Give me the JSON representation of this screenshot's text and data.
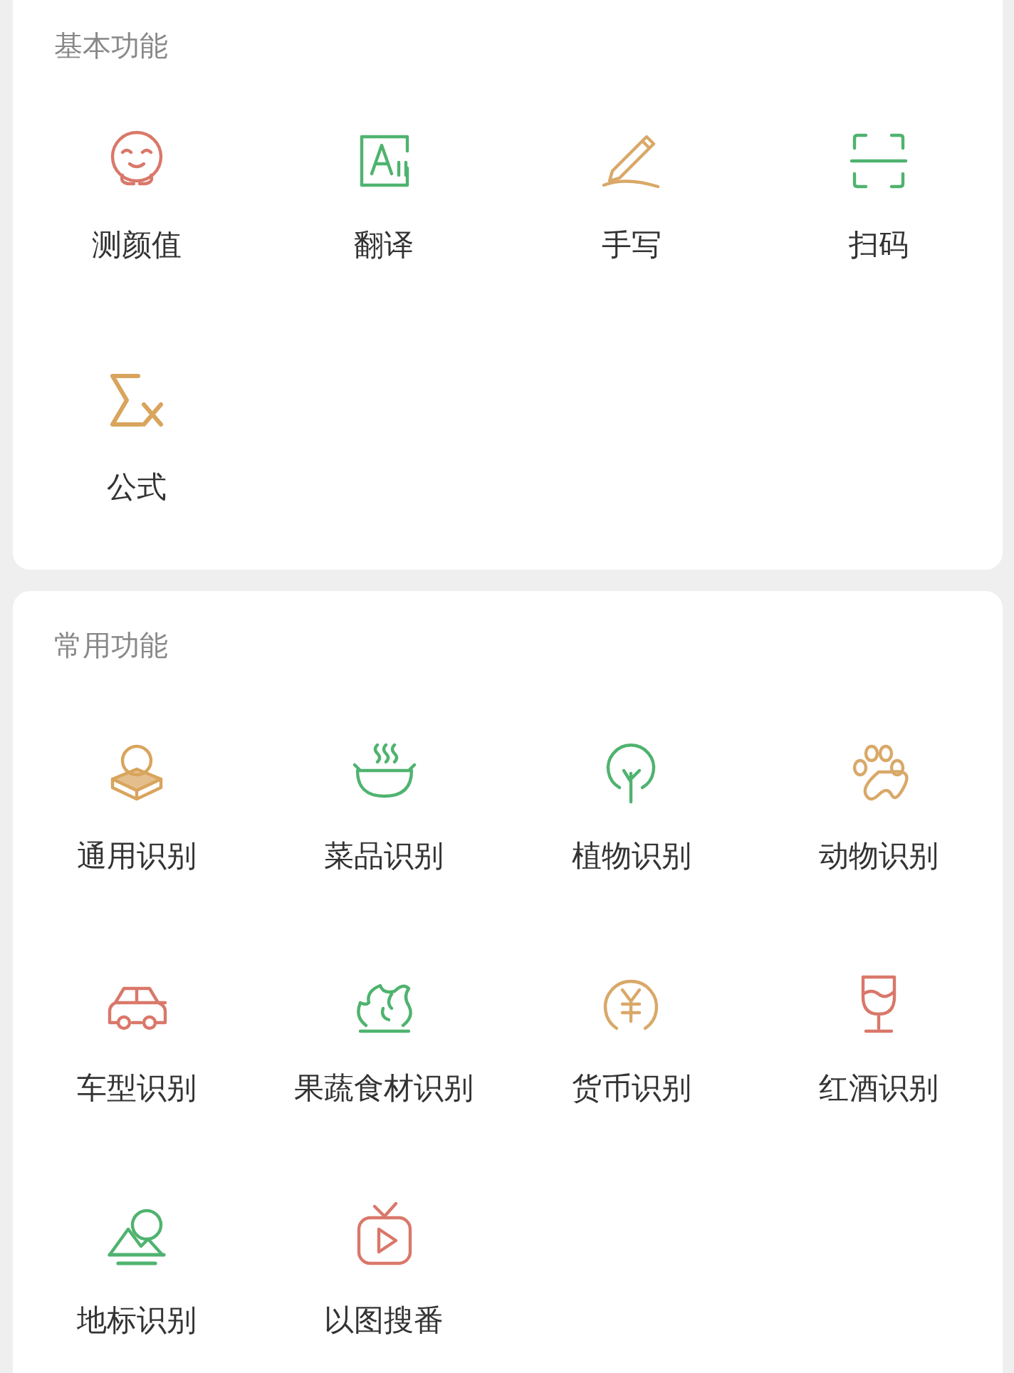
{
  "sections": [
    {
      "title": "基本功能",
      "items": [
        {
          "label": "测颜值",
          "kind": "face",
          "color": "#d9786a"
        },
        {
          "label": "翻译",
          "kind": "translate",
          "color": "#4fb36f"
        },
        {
          "label": "手写",
          "kind": "pen",
          "color": "#d9a868"
        },
        {
          "label": "扫码",
          "kind": "scan",
          "color": "#4fb36f"
        },
        {
          "label": "公式",
          "kind": "formula",
          "color": "#d9a45c"
        }
      ]
    },
    {
      "title": "常用功能",
      "items": [
        {
          "label": "通用识别",
          "kind": "object",
          "color": "#d9a45c"
        },
        {
          "label": "菜品识别",
          "kind": "dish",
          "color": "#4fb36f"
        },
        {
          "label": "植物识别",
          "kind": "plant",
          "color": "#4fb36f"
        },
        {
          "label": "动物识别",
          "kind": "paw",
          "color": "#d9a868"
        },
        {
          "label": "车型识别",
          "kind": "car",
          "color": "#d9786a"
        },
        {
          "label": "果蔬食材识别",
          "kind": "veg",
          "color": "#4fb36f"
        },
        {
          "label": "货币识别",
          "kind": "coin",
          "color": "#d9a868"
        },
        {
          "label": "红酒识别",
          "kind": "wine",
          "color": "#d9786a"
        },
        {
          "label": "地标识别",
          "kind": "landmark",
          "color": "#4fb36f"
        },
        {
          "label": "以图搜番",
          "kind": "tv",
          "color": "#d9786a"
        }
      ]
    }
  ]
}
